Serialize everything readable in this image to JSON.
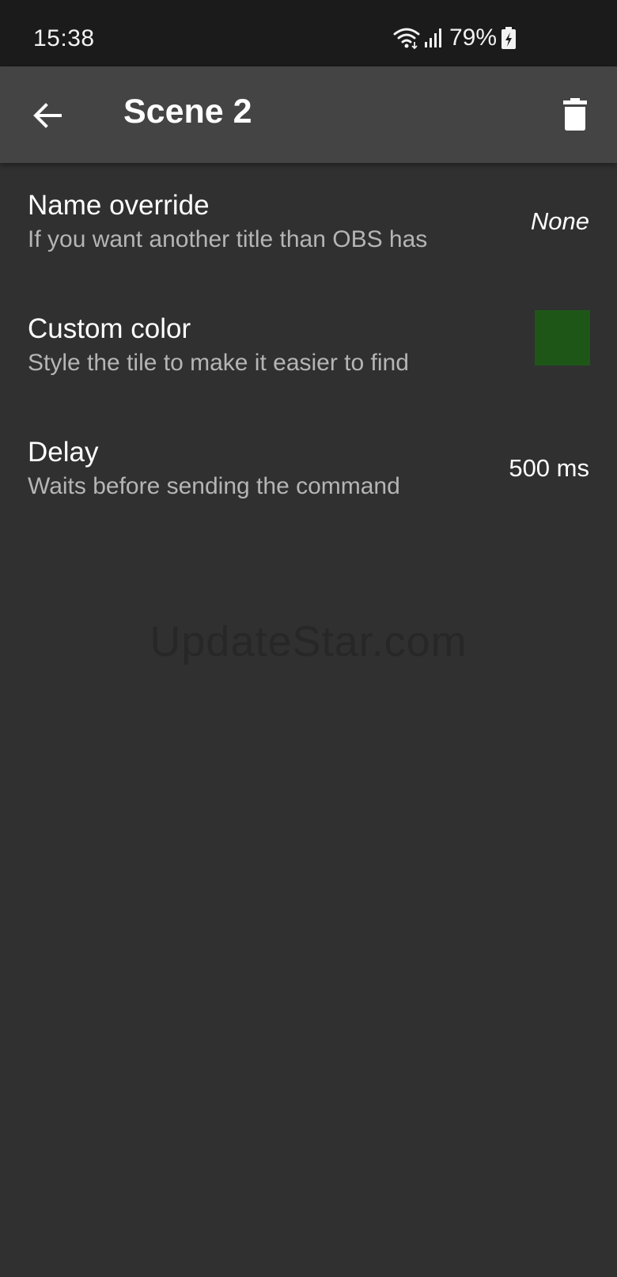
{
  "status_bar": {
    "time": "15:38",
    "battery_percent": "79%",
    "icons": [
      "wifi-icon",
      "signal-icon",
      "battery-charging-icon"
    ]
  },
  "app_bar": {
    "title": "Scene 2",
    "back_icon": "arrow-back-icon",
    "delete_icon": "trash-icon"
  },
  "settings": [
    {
      "title": "Name override",
      "subtitle": "If you want another title than OBS has",
      "value": "None"
    },
    {
      "title": "Custom color",
      "subtitle": "Style the tile to make it easier to find",
      "swatch_color": "#1e5617"
    },
    {
      "title": "Delay",
      "subtitle": "Waits before sending the command",
      "value": "500 ms"
    }
  ],
  "watermark": "UpdateStar.com",
  "colors": {
    "background": "#303030",
    "app_bar": "#444444",
    "status_bar": "#1b1b1b"
  }
}
